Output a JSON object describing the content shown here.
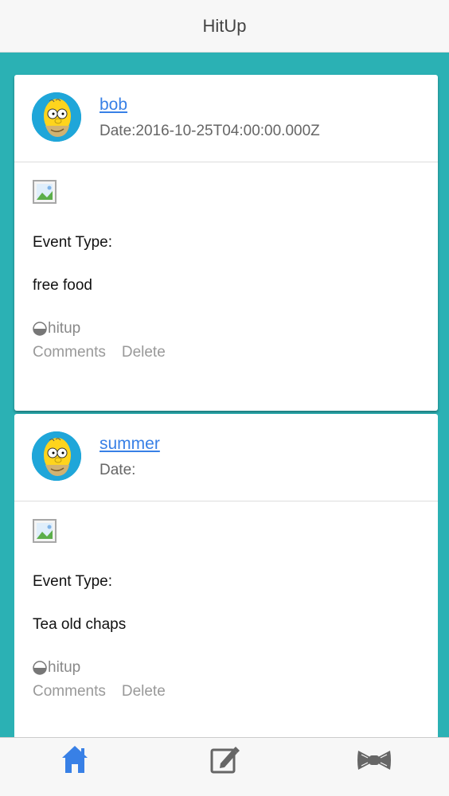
{
  "header": {
    "title": "HitUp"
  },
  "posts": [
    {
      "username": "bob",
      "date": "Date:2016-10-25T04:00:00.000Z",
      "event_type_label": "Event Type:",
      "event_value": "free food",
      "tag": "hitup",
      "comments_label": "Comments",
      "delete_label": "Delete"
    },
    {
      "username": "summer",
      "date": "Date:",
      "event_type_label": "Event Type:",
      "event_value": "Tea old chaps",
      "tag": "hitup",
      "comments_label": "Comments",
      "delete_label": "Delete"
    }
  ],
  "tabbar": {
    "items": [
      {
        "icon": "home-icon",
        "active": true
      },
      {
        "icon": "compose-icon",
        "active": false
      },
      {
        "icon": "bowtie-icon",
        "active": false
      }
    ]
  },
  "colors": {
    "background": "#2bb1b4",
    "link": "#3880e6",
    "active_tab": "#3880e6",
    "inactive_tab": "#666666"
  }
}
